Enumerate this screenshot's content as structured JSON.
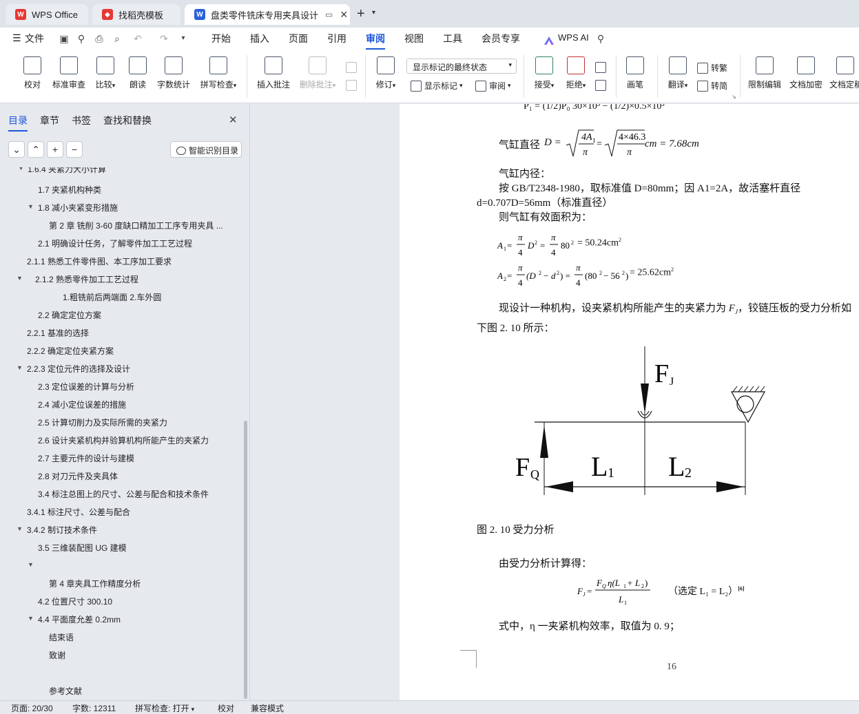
{
  "tabs": {
    "t1": "WPS Office",
    "t2": "找稻壳模板",
    "t3": "盘类零件铣床专用夹具设计 说"
  },
  "menu": {
    "file": "文件",
    "items": [
      "开始",
      "插入",
      "页面",
      "引用",
      "审阅",
      "视图",
      "工具",
      "会员专享"
    ],
    "active": "审阅",
    "ai": "WPS AI"
  },
  "ribbon": {
    "proof": "校对",
    "std_review": "标准审查",
    "compare": "比较",
    "read": "朗读",
    "word_count": "字数统计",
    "spell": "拼写检查",
    "insert_comment": "插入批注",
    "delete_comment": "删除批注",
    "revise": "修订",
    "track_state": "显示标记的最终状态",
    "show_marks": "显示标记",
    "review": "审阅",
    "accept": "接受",
    "reject": "拒绝",
    "pen": "画笔",
    "translate": "翻译",
    "to_trad": "转繁",
    "to_simp": "转简",
    "restrict": "限制编辑",
    "encrypt": "文档加密",
    "finalize": "文档定稿"
  },
  "panel": {
    "tab_toc": "目录",
    "tab_chapter": "章节",
    "tab_bookmark": "书签",
    "tab_find": "查找和替换",
    "smart_btn": "智能识别目录",
    "toc": [
      "1.6.4 夹紧力大小计算",
      "1.7 夹紧机构种类",
      "1.8 减小夹紧变形措施",
      "第 2 章 铣削 3-60 度缺口精加工工序专用夹具 ...",
      "2.1 明确设计任务，了解零件加工工艺过程",
      "2.1.1 熟悉工件零件图、本工序加工要求",
      "2.1.2 熟悉零件加工工艺过程",
      "1.粗铣前后两端面 2.车外圆",
      "2.2 确定定位方案",
      "2.2.1 基准的选择",
      "2.2.2 确定定位夹紧方案",
      "2.2.3 定位元件的选择及设计",
      "2.3 定位误差的计算与分析",
      "2.4 减小定位误差的措施",
      "2.5 计算切削力及实际所需的夹紧力",
      "2.6 设计夹紧机构并验算机构所能产生的夹紧力",
      "2.7 主要元件的设计与建模",
      "2.8 对刀元件及夹具体",
      "3.4 标注总图上的尺寸、公差与配合和技术条件",
      "3.4.1 标注尺寸、公差与配合",
      "3.4.2 制订技术条件",
      "3.5 三维装配图 UG 建模",
      "",
      "第 4 章夹具工作精度分析",
      "4.2 位置尺寸 300.10",
      "4.4 平面度允差 0.2mm",
      "结束语",
      "致谢",
      "",
      "参考文献"
    ]
  },
  "doc": {
    "formula_top": "P₁ = (1/2)P₀    30×10³ − (1/2)×0.5×10³",
    "cyl_diam_label": "气缸直径",
    "cyl_diam_result": "cm = 7.68cm",
    "inner_diam": "气缸内径：",
    "std_line1": "按 GB/T2348-1980，取标准值 D=80mm；因 A1=2A，故活塞杆直径",
    "std_line2": "d=0.707D=56mm（标准直径）",
    "eff_area": "则气缸有效面积为：",
    "a1_result": "= 50.24cm",
    "a2_result": "= 25.62cm",
    "para1": "现设计一种机构，设夹紧机构所能产生的夹紧力为",
    "para1_b": "，铰链压板的受力分析如",
    "para2": "下图 2. 10 所示：",
    "fig_FJ": "F",
    "fig_FJ_sub": "J",
    "fig_FQ": "F",
    "fig_FQ_sub": "Q",
    "fig_L1": "L",
    "fig_L1_sub": "1",
    "fig_L2": "L",
    "fig_L2_sub": "2",
    "caption": "图 2. 10 受力分析",
    "calc_intro": "由受力分析计算得：",
    "select_note": "（选定 L₁ = L₂）",
    "ref": "[6]",
    "eta_line": "式中，η 一夹紧机构效率，取值为 0. 9；",
    "page_num": "16"
  },
  "status": {
    "page": "页面: 20/30",
    "words": "字数: 12311",
    "spell": "拼写检查: 打开",
    "proof": "校对",
    "compat": "兼容模式"
  }
}
